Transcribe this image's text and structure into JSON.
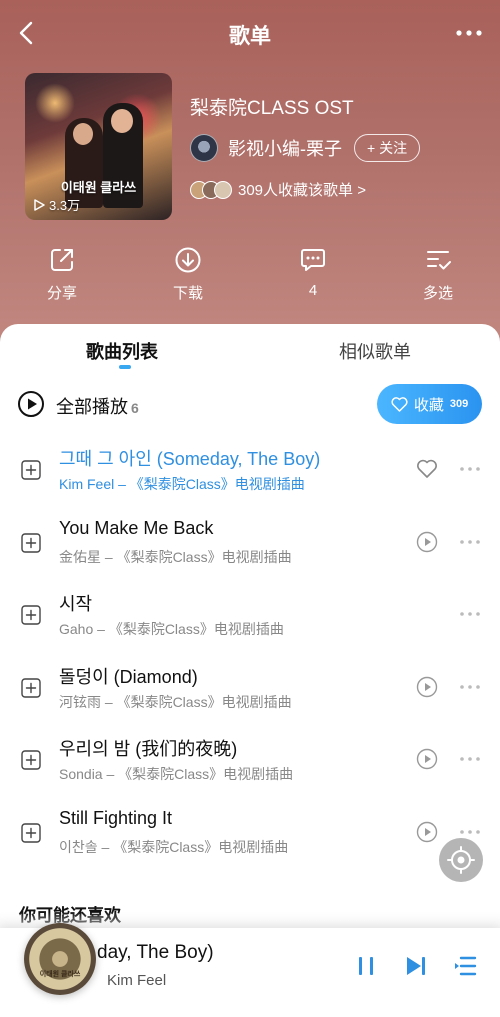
{
  "header": {
    "title": "歌单"
  },
  "playlist": {
    "name": "梨泰院CLASS OST",
    "cover_title": "이태원 클라쓰",
    "play_count": "3.3万",
    "creator_name": "影视小编-栗子",
    "follow_label": "+ 关注",
    "collectors_text": "309人收藏该歌单 >"
  },
  "actions": [
    {
      "label": "分享",
      "icon": "share-icon"
    },
    {
      "label": "下载",
      "icon": "download-icon"
    },
    {
      "label": "4",
      "icon": "comment-icon"
    },
    {
      "label": "多选",
      "icon": "multi-select-icon"
    }
  ],
  "tabs": {
    "active": "歌曲列表",
    "inactive": "相似歌单"
  },
  "play_all": {
    "label": "全部播放",
    "count": "6",
    "collect_label": "收藏",
    "collect_count": "309"
  },
  "songs": [
    {
      "title": "그때 그 아인 (Someday, The Boy)",
      "subtitle": "Kim Feel – 《梨泰院Class》电视剧插曲",
      "active": true,
      "trailing_icon": "heart-icon"
    },
    {
      "title": "You Make Me Back",
      "subtitle": "金佑星 – 《梨泰院Class》电视剧插曲",
      "active": false,
      "trailing_icon": "mv-play-icon"
    },
    {
      "title": "시작",
      "subtitle": "Gaho – 《梨泰院Class》电视剧插曲",
      "active": false,
      "trailing_icon": ""
    },
    {
      "title": "돌덩이 (Diamond)",
      "subtitle": "河铉雨 – 《梨泰院Class》电视剧插曲",
      "active": false,
      "trailing_icon": "mv-play-icon"
    },
    {
      "title": "우리의 밤 (我们的夜晚)",
      "subtitle": "Sondia – 《梨泰院Class》电视剧插曲",
      "active": false,
      "trailing_icon": "mv-play-icon"
    },
    {
      "title": "Still Fighting It",
      "subtitle": "이찬솔 – 《梨泰院Class》电视剧插曲",
      "active": false,
      "trailing_icon": "mv-play-icon"
    }
  ],
  "recommend": {
    "title": "你可能还喜欢"
  },
  "player": {
    "title": "day, The Boy)",
    "artist": "Kim Feel",
    "disc_text": "이태원 클라쓰"
  },
  "colors": {
    "accent": "#2f8fe0",
    "header_bg": "#b0706a"
  }
}
